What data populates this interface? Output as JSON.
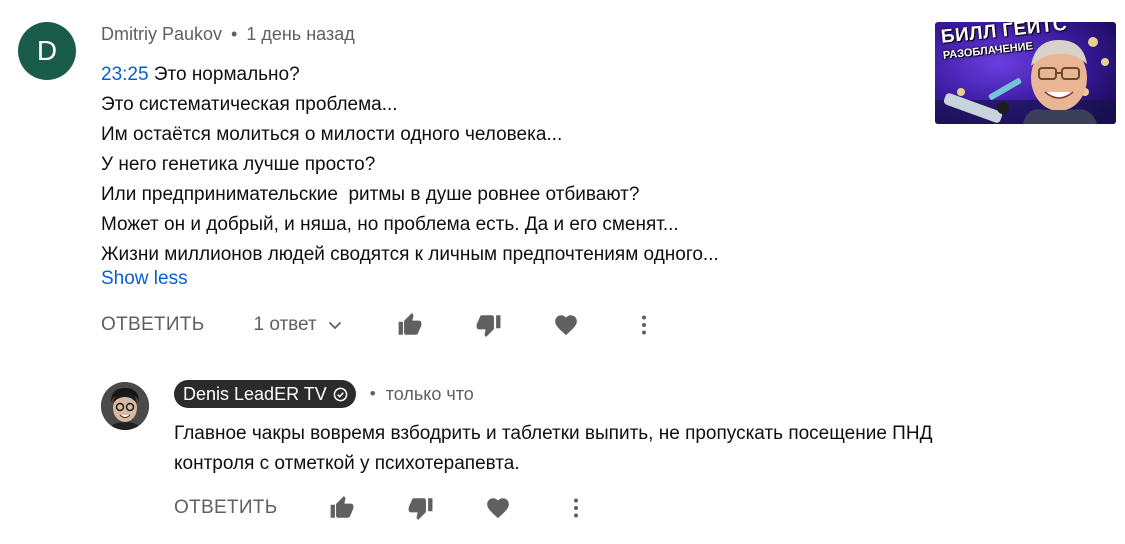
{
  "comment": {
    "avatar_letter": "D",
    "author": "Dmitriy Paukov",
    "separator": "•",
    "time": "1 день назад",
    "timestamp_link": "23:25",
    "first_line_text": " Это нормально?",
    "lines": [
      "Это систематическая проблема...",
      "Им остаётся молиться о милости одного человека...",
      "У него генетика лучше просто?",
      "Или предпринимательские  ритмы в душе ровнее отбивают?",
      "Может он и добрый, и няша, но проблема есть. Да и его сменят...",
      "Жизни миллионов людей сводятся к личным предпочтениям одного..."
    ],
    "show_less": "Show less",
    "reply_label": "ОТВЕТИТЬ",
    "replies_toggle_label": "1 ответ"
  },
  "video_thumbnail": {
    "title_line1": "БИЛЛ ГЕЙТС",
    "title_line2": "РАЗОБЛАЧЕНИЕ"
  },
  "reply": {
    "author": "Denis LeadER TV",
    "separator": "•",
    "time": "только что",
    "text": "Главное чакры вовремя взбодрить и таблетки выпить, не пропускать посещение ПНД контроля с отметкой у психотерапевта.",
    "reply_label": "ОТВЕТИТЬ"
  },
  "icons": {
    "like": "thumbs-up-icon",
    "dislike": "thumbs-down-icon",
    "heart": "heart-icon",
    "more": "more-vertical-icon",
    "chevron": "chevron-down-icon",
    "verified": "verified-check-icon"
  },
  "colors": {
    "link": "#065fd4",
    "secondary_text": "#606060",
    "avatar_bg": "#1a5c4a",
    "author_chip_bg": "#2b2b2b"
  }
}
